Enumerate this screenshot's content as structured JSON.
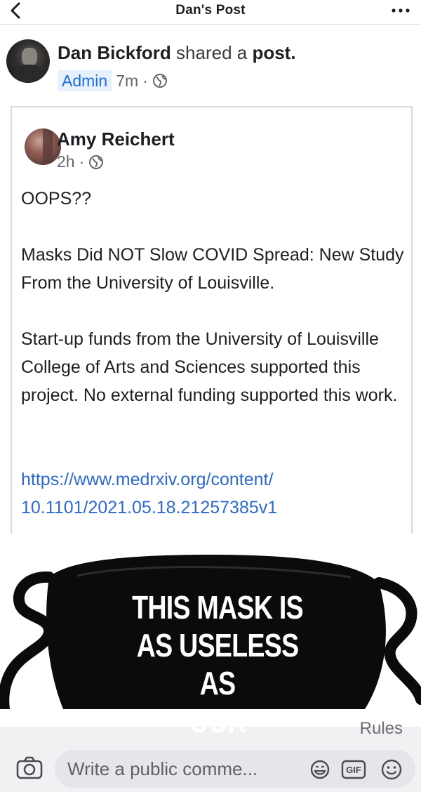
{
  "topbar": {
    "title": "Dan's Post",
    "back_icon": "chevron-left-icon",
    "more_icon": "more-options-icon"
  },
  "post": {
    "author": "Dan Bickford",
    "action_text": " shared a ",
    "post_word": "post.",
    "badge": "Admin",
    "time": "7m",
    "separator": "·",
    "privacy_icon": "globe-icon",
    "shared": {
      "author": "Amy Reichert",
      "time": "2h",
      "separator": "·",
      "privacy_icon": "globe-icon",
      "paragraphs": [
        "OOPS??",
        "Masks Did NOT Slow COVID Spread: New Study From the University of Louisville.",
        "Start-up funds from the University of Louisville College of Arts and Sciences supported this project. No external funding supported this work."
      ],
      "link_line1": "https://www.medrxiv.org/content/",
      "link_line2": "10.1101/2021.05.18.21257385v1"
    },
    "image": {
      "mask_line1": "THIS MASK IS",
      "mask_line2": "AS USELESS AS",
      "mask_line3": "OUR GOVERNOR"
    }
  },
  "comments": {
    "rules_label": "Rules",
    "input_placeholder": "Write a public comme...",
    "camera_icon": "camera-icon",
    "sticker_icon": "sticker-icon",
    "gif_icon": "gif-icon",
    "emoji_icon": "emoji-icon"
  },
  "colors": {
    "link": "#2d69d1",
    "badge_bg": "#e7f0fd",
    "badge_text": "#1f6fd8",
    "mask_black": "#0b0b0b"
  }
}
